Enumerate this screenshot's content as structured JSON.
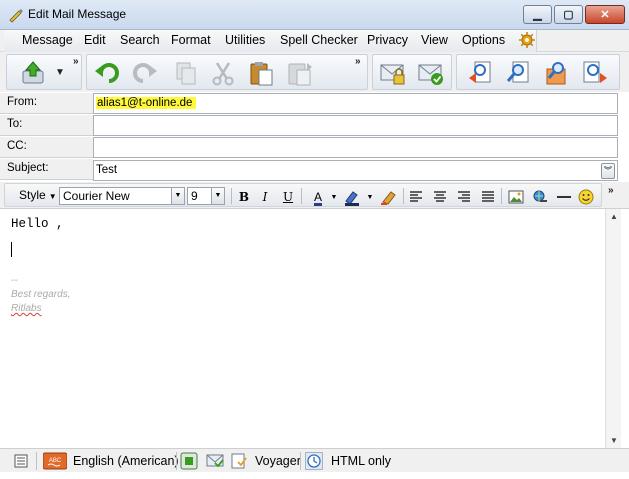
{
  "window": {
    "title": "Edit Mail Message",
    "controls": {
      "minimize": "minimize",
      "maximize": "maximize",
      "close": "close"
    }
  },
  "menu": [
    {
      "label": "Message"
    },
    {
      "label": "Edit"
    },
    {
      "label": "Search"
    },
    {
      "label": "Format"
    },
    {
      "label": "Utilities"
    },
    {
      "label": "Spell Checker"
    },
    {
      "label": "Privacy"
    },
    {
      "label": "View"
    },
    {
      "label": "Options"
    }
  ],
  "toolbar": {
    "overflow": "»",
    "buttons": [
      "send-icon",
      "undo-icon",
      "redo-icon",
      "copy-icon",
      "cut-icon",
      "paste-icon",
      "paste-special-icon",
      "encrypt-icon",
      "sign-icon",
      "reply-icon",
      "find-icon",
      "find-next-icon",
      "forward-icon"
    ]
  },
  "header": {
    "from_label": "From:",
    "from_value": "alias1@t-online.de",
    "to_label": "To:",
    "to_value": "",
    "cc_label": "CC:",
    "cc_value": "",
    "subject_label": "Subject:",
    "subject_value": "Test"
  },
  "format": {
    "style_label": "Style",
    "font_name": "Courier New",
    "font_size": "9",
    "bold": "B",
    "italic": "I",
    "underline": "U",
    "font_color": "A",
    "overflow": "»"
  },
  "body": {
    "greeting": "Hello ,",
    "sig_dashes": "--",
    "sig_regards": "Best regards,",
    "sig_name": "Ritlabs"
  },
  "status": {
    "language": "English (American)",
    "template": "Voyager",
    "mode": "HTML only"
  },
  "colors": {
    "highlight": "#fff83b",
    "accent_green": "#3a9c1e",
    "close_red": "#c7462a"
  }
}
